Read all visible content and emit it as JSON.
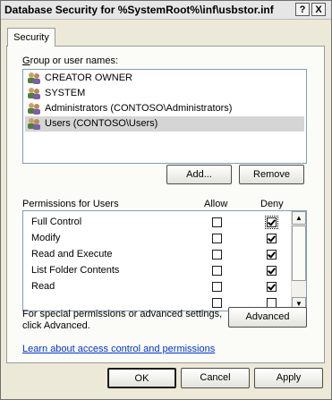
{
  "window": {
    "title": "Database Security for %SystemRoot%\\inf\\usbstor.inf",
    "help_button": "?",
    "close_button": "X"
  },
  "tabs": [
    {
      "label": "Security"
    }
  ],
  "group_section": {
    "label": "Group or user names:",
    "users": [
      {
        "name": "CREATOR OWNER",
        "selected": false
      },
      {
        "name": "SYSTEM",
        "selected": false
      },
      {
        "name": "Administrators (CONTOSO\\Administrators)",
        "selected": false
      },
      {
        "name": "Users (CONTOSO\\Users)",
        "selected": true
      }
    ],
    "add_label": "Add...",
    "remove_label": "Remove"
  },
  "permissions": {
    "label": "Permissions for Users",
    "allow_header": "Allow",
    "deny_header": "Deny",
    "rows": [
      {
        "name": "Full Control",
        "allow": false,
        "deny": true
      },
      {
        "name": "Modify",
        "allow": false,
        "deny": true
      },
      {
        "name": "Read and Execute",
        "allow": false,
        "deny": true
      },
      {
        "name": "List Folder Contents",
        "allow": false,
        "deny": true
      },
      {
        "name": "Read",
        "allow": false,
        "deny": true
      }
    ]
  },
  "advanced": {
    "text_line1": "For special permissions or advanced settings,",
    "text_line2": "click Advanced.",
    "button_label": "Advanced"
  },
  "learn_link": "Learn about access control and permissions",
  "footer": {
    "ok": "OK",
    "cancel": "Cancel",
    "apply": "Apply"
  }
}
